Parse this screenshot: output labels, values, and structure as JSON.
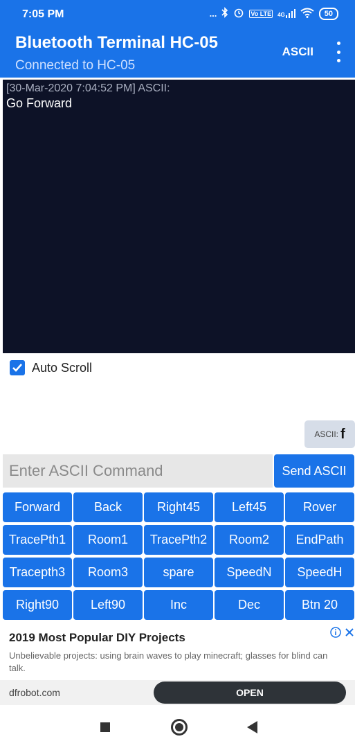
{
  "status_bar": {
    "time": "7:05 PM",
    "icons": [
      "more-dots-icon",
      "bluetooth-icon",
      "alarm-icon",
      "volte-icon",
      "signal-4g-icon",
      "wifi-icon",
      "battery-icon"
    ],
    "dots": "...",
    "volte": "Vo LTE",
    "network": "4G",
    "battery": "50"
  },
  "app_bar": {
    "title": "Bluetooth Terminal HC-05",
    "subtitle": "Connected to HC-05",
    "mode_label": "ASCII"
  },
  "terminal": {
    "timestamp": "[30-Mar-2020 7:04:52 PM] ASCII:",
    "message": "Go Forward"
  },
  "auto_scroll": {
    "label": "Auto Scroll",
    "checked": true
  },
  "ascii_chip": {
    "label": "ASCII:",
    "value": "f"
  },
  "command": {
    "placeholder": "Enter ASCII Command",
    "send_label": "Send ASCII"
  },
  "buttons": [
    "Forward",
    "Back",
    "Right45",
    "Left45",
    "Rover",
    "TracePth1",
    "Room1",
    "TracePth2",
    "Room2",
    "EndPath",
    "Tracepth3",
    "Room3",
    "spare",
    "SpeedN",
    "SpeedH",
    "Right90",
    "Left90",
    "Inc",
    "Dec",
    "Btn 20"
  ],
  "ad": {
    "title": "2019 Most Popular DIY Projects",
    "description": "Unbelievable projects: using brain waves to play minecraft; glasses for blind can talk.",
    "domain": "dfrobot.com",
    "cta": "OPEN"
  },
  "colors": {
    "primary": "#1a73e8",
    "terminal_bg": "#0d1227"
  }
}
